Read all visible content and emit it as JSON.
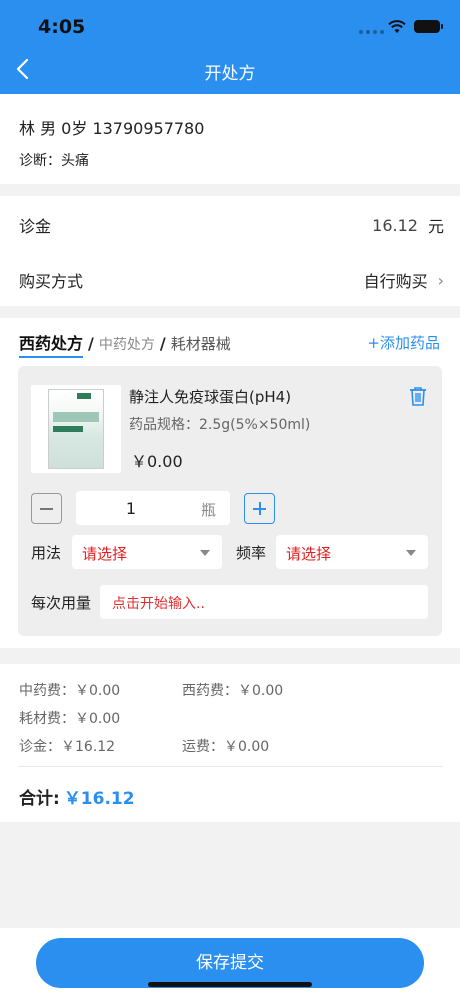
{
  "status": {
    "time": "4:05"
  },
  "nav": {
    "title": "开处方"
  },
  "patient": {
    "info": "林   男 0岁 13790957780",
    "diagnosis": "诊断：头痛"
  },
  "fees": {
    "consult_label": "诊金",
    "consult_value": "16.12",
    "consult_unit": "元",
    "purchase_label": "购买方式",
    "purchase_value": "自行购买"
  },
  "tabs": {
    "western": "西药处方",
    "sep": "/",
    "chinese": "中药处方",
    "consumables": "耗材器械",
    "add_drug": "+添加药品"
  },
  "drug": {
    "name": "静注人免疫球蛋白(pH4)",
    "spec": "药品规格：2.5g(5%×50ml)",
    "price": "￥0.00",
    "quantity": "1",
    "unit": "瓶",
    "usage_label": "用法",
    "usage_placeholder": "请选择",
    "freq_label": "频率",
    "freq_placeholder": "请选择",
    "dose_label": "每次用量",
    "dose_placeholder": "点击开始输入.."
  },
  "summary": {
    "chinese_fee": "中药费：￥0.00",
    "western_fee": "西药费：￥0.00",
    "consumable_fee": "耗材费：￥0.00",
    "consult_fee": "诊金：￥16.12",
    "shipping_fee": "运费：￥0.00",
    "total_label": "合计:",
    "total_amount": "￥16.12"
  },
  "actions": {
    "submit": "保存提交"
  },
  "colors": {
    "accent": "#2b8ff0",
    "placeholder_red": "#e02020"
  }
}
